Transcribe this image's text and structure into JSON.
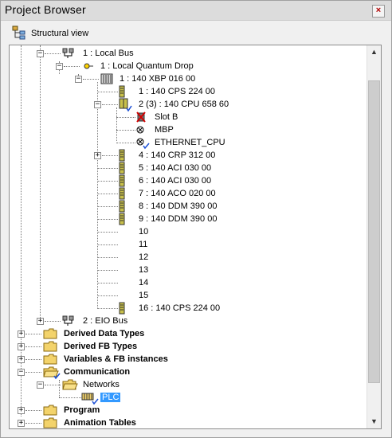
{
  "window": {
    "title": "Project Browser",
    "close_label": "×"
  },
  "toolbar": {
    "view_label": "Structural view"
  },
  "tree": {
    "local_bus": "1 : Local Bus",
    "local_drop": "1 : Local Quantum Drop",
    "rack": "1 : 140 XBP 016 00",
    "slot1": "1 : 140 CPS 224 00",
    "slot2": "2 (3) : 140 CPU 658 60",
    "slot_b": "Slot B",
    "mbp": "MBP",
    "eth": "ETHERNET_CPU",
    "slot4": "4 : 140 CRP 312 00",
    "slot5": "5 : 140 ACI 030 00",
    "slot6": "6 : 140 ACI 030 00",
    "slot7": "7 : 140 ACO 020 00",
    "slot8": "8 : 140 DDM 390 00",
    "slot9": "9 : 140 DDM 390 00",
    "slot10": "10",
    "slot11": "11",
    "slot12": "12",
    "slot13": "13",
    "slot14": "14",
    "slot15": "15",
    "slot16": "16 : 140 CPS 224 00",
    "eio_bus": "2 : EIO Bus",
    "derived_data": "Derived Data Types",
    "derived_fb": "Derived FB Types",
    "variables": "Variables & FB instances",
    "communication": "Communication",
    "networks": "Networks",
    "plc": "PLC",
    "program": "Program",
    "animation": "Animation Tables"
  },
  "icons": {
    "folder": "folder-icon",
    "module": "module-icon",
    "rack": "rack-icon",
    "bus": "bus-icon",
    "drop": "drop-icon",
    "port": "port-icon",
    "network": "network-icon"
  },
  "colors": {
    "selection": "#3399ff",
    "folder": "#f3d36b",
    "module": "#c8c04a"
  }
}
